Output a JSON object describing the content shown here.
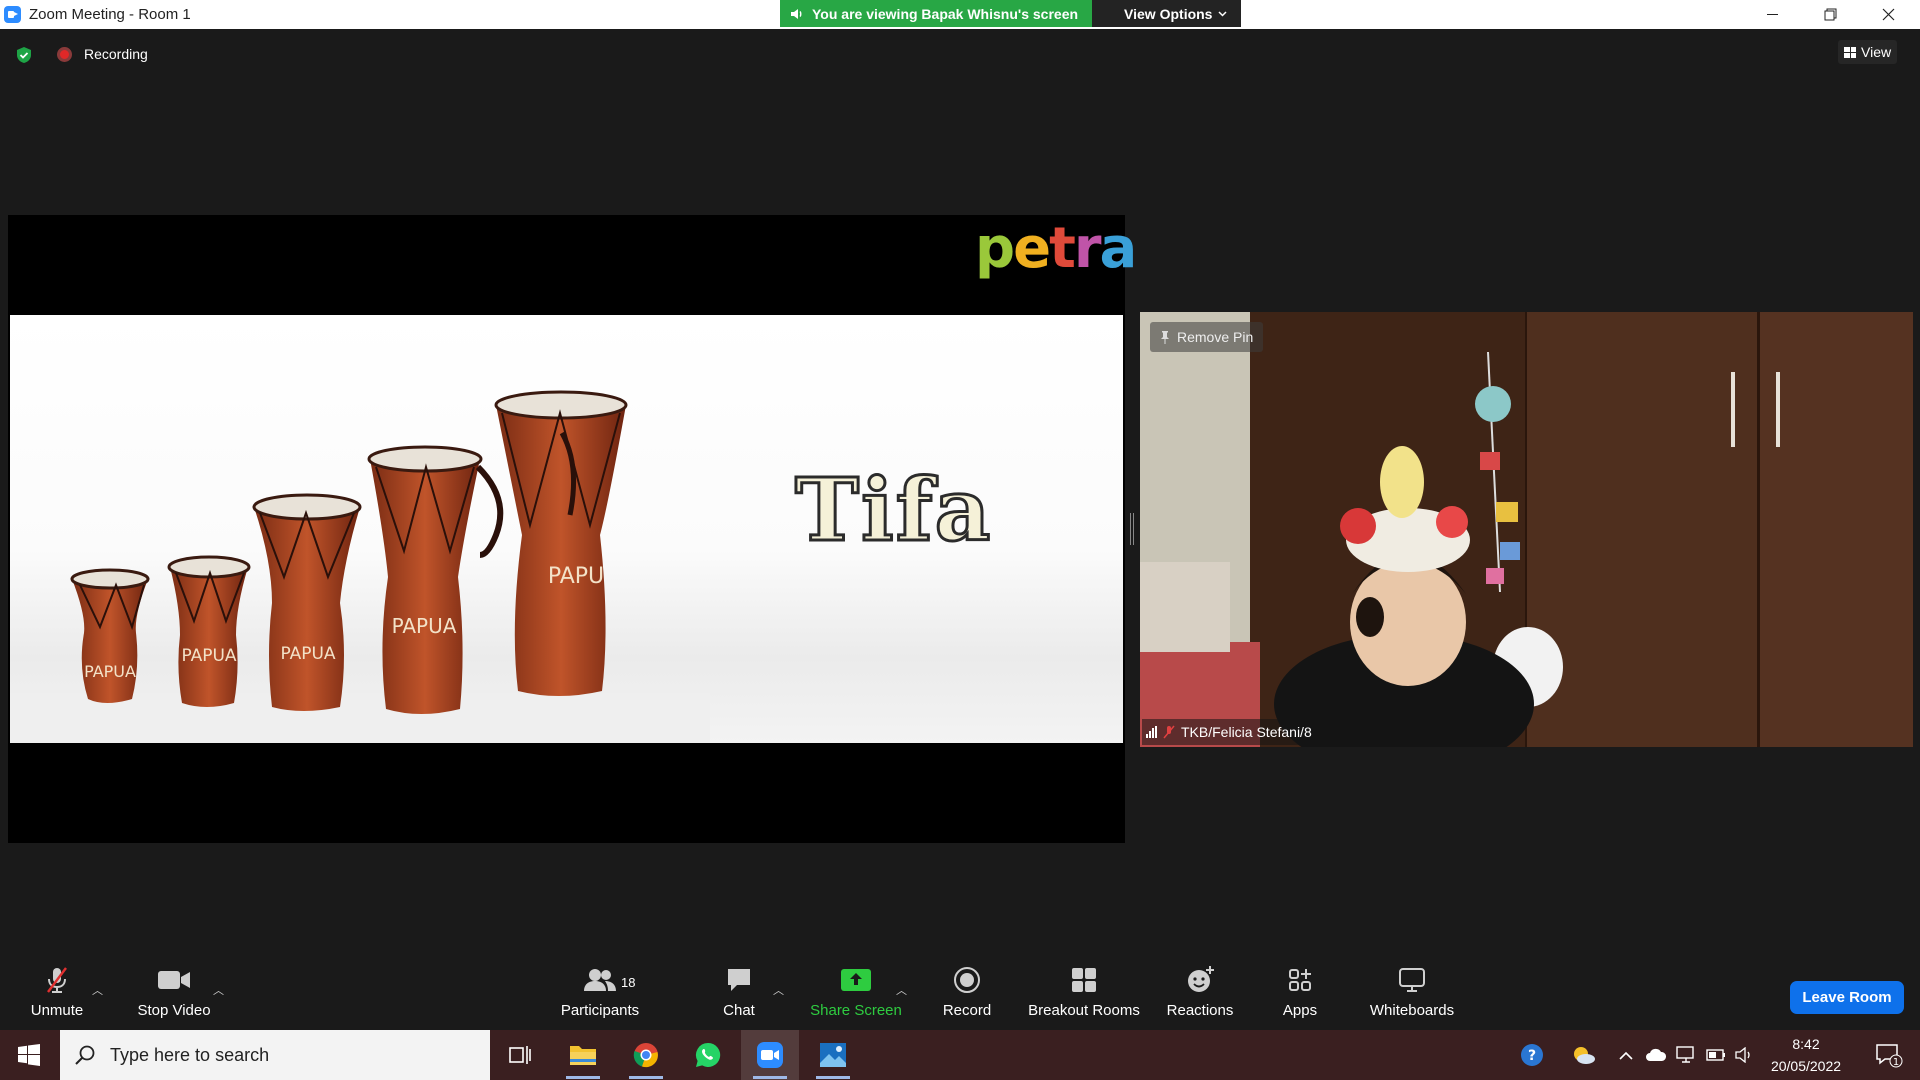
{
  "window": {
    "title": "Zoom Meeting - Room 1",
    "sharing_banner": "You are viewing Bapak Whisnu's screen",
    "view_options_label": "View Options"
  },
  "meeting": {
    "recording_label": "Recording",
    "view_label": "View"
  },
  "shared_screen": {
    "logo_text": [
      "p",
      "e",
      "t",
      "r",
      "a"
    ],
    "slide_title": "Tifa",
    "drum_labels": [
      "PAPUA",
      "PAPUA",
      "PAPUA",
      "PAPUA",
      "PAPU"
    ]
  },
  "participant_video": {
    "remove_pin_label": "Remove Pin",
    "name": "TKB/Felicia Stefani/8"
  },
  "toolbar": {
    "unmute": "Unmute",
    "stop_video": "Stop Video",
    "participants": "Participants",
    "participants_count": "18",
    "chat": "Chat",
    "share_screen": "Share Screen",
    "record": "Record",
    "breakout_rooms": "Breakout Rooms",
    "reactions": "Reactions",
    "apps": "Apps",
    "whiteboards": "Whiteboards",
    "leave_room": "Leave Room"
  },
  "taskbar": {
    "search_placeholder": "Type here to search",
    "time": "8:42",
    "date": "20/05/2022",
    "notification_count": "1"
  },
  "colors": {
    "accent_blue": "#0e71eb",
    "share_green": "#28a745",
    "recording_red": "#e02828",
    "taskbar": "#3a1f20"
  }
}
